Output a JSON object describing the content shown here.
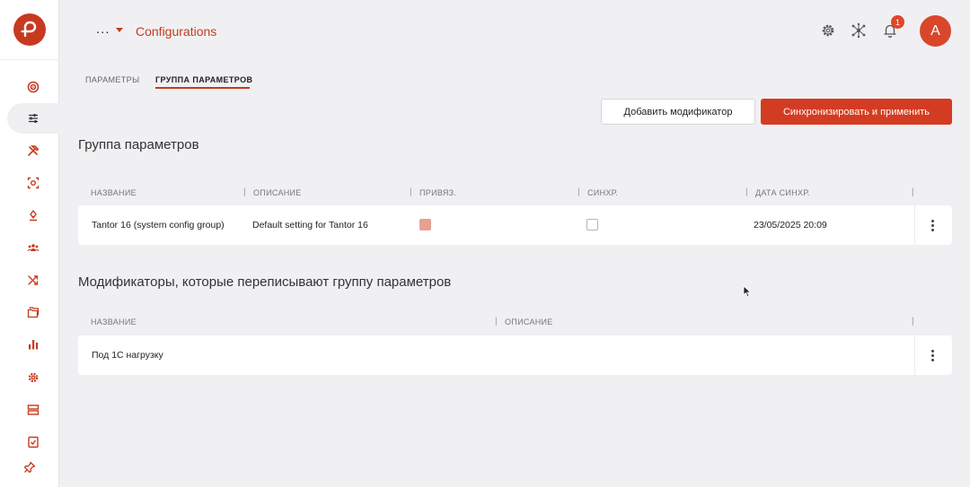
{
  "header": {
    "crumb_dots": "...",
    "title": "Configurations",
    "notification_count": "1",
    "avatar_letter": "A"
  },
  "sidebar": {
    "items": [
      {
        "icon": "target-icon"
      },
      {
        "icon": "sliders-icon",
        "active": true
      },
      {
        "icon": "tools-icon"
      },
      {
        "icon": "scan-icon"
      },
      {
        "icon": "database-icon"
      },
      {
        "icon": "users-icon"
      },
      {
        "icon": "shuffle-icon"
      },
      {
        "icon": "folders-icon"
      },
      {
        "icon": "bar-chart-icon"
      },
      {
        "icon": "gear-icon"
      },
      {
        "icon": "server-icon"
      },
      {
        "icon": "clipboard-check-icon"
      },
      {
        "icon": "pin-icon"
      }
    ]
  },
  "tabs": [
    {
      "label": "ПАРАМЕТРЫ",
      "active": false
    },
    {
      "label": "ГРУППА ПАРАМЕТРОВ",
      "active": true
    }
  ],
  "actions": {
    "add_modifier": "Добавить модификатор",
    "sync_apply": "Синхронизировать и применить"
  },
  "group_section": {
    "title": "Группа параметров",
    "columns": [
      "НАЗВАНИЕ",
      "ОПИСАНИЕ",
      "ПРИВЯЗ.",
      "СИНХР.",
      "ДАТА СИНХР."
    ],
    "rows": [
      {
        "name": "Tantor 16 (system config group)",
        "description": "Default setting for Tantor 16",
        "linked": true,
        "synced": false,
        "sync_date": "23/05/2025 20:09"
      }
    ]
  },
  "modifiers_section": {
    "title": "Модификаторы, которые переписывают группу параметров",
    "columns": [
      "НАЗВАНИЕ",
      "ОПИСАНИЕ"
    ],
    "rows": [
      {
        "name": "Под 1С нагрузку",
        "description": ""
      }
    ]
  },
  "colors": {
    "accent": "#c73a20",
    "primary_button": "#d33c22",
    "background": "#f0f0f3",
    "checkbox_checked": "#e6a290"
  }
}
